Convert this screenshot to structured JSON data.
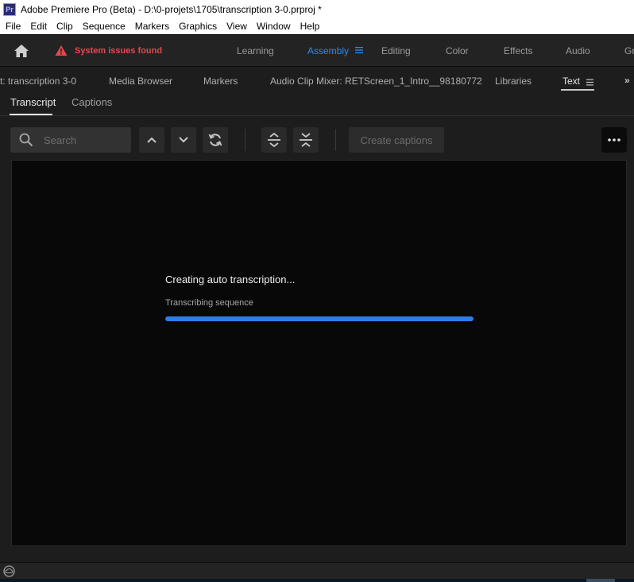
{
  "window": {
    "title": "Adobe Premiere Pro (Beta) - D:\\0-projets\\1705\\transcription 3-0.prproj *",
    "app_icon": "Pr"
  },
  "menu": [
    "File",
    "Edit",
    "Clip",
    "Sequence",
    "Markers",
    "Graphics",
    "View",
    "Window",
    "Help"
  ],
  "workspace": {
    "home_icon": "home-icon",
    "warning": "System issues found",
    "tabs": [
      "Learning",
      "Assembly",
      "Editing",
      "Color",
      "Effects",
      "Audio",
      "Gr"
    ],
    "active_tab": "Assembly",
    "accent_color": "#2f8bea",
    "warning_color": "#e34850"
  },
  "panel_tabs": [
    "t: transcription 3-0",
    "Media Browser",
    "Markers",
    "Audio Clip Mixer: RETScreen_1_Intro__98180772",
    "Libraries",
    "Text"
  ],
  "active_panel_tab": "Text",
  "sub_tabs": [
    "Transcript",
    "Captions"
  ],
  "active_sub_tab": "Transcript",
  "toolbar": {
    "search_placeholder": "Search",
    "create_captions": "Create captions",
    "buttons": [
      "chevron-up-icon",
      "chevron-down-icon",
      "sync-icon",
      "expand-icon",
      "collapse-icon",
      "more-icon"
    ]
  },
  "progress": {
    "title": "Creating auto transcription...",
    "subtitle": "Transcribing sequence",
    "value": 1.0,
    "color": "#2e7ee5"
  }
}
